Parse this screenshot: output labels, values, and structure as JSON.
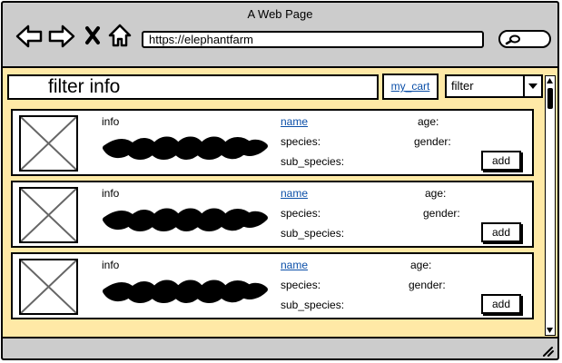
{
  "window": {
    "title": "A Web Page"
  },
  "browser": {
    "url": "https://elephantfarm"
  },
  "toolbar": {
    "filter_text": "filter info",
    "cart_label": "my_cart",
    "filter_select_value": "filter"
  },
  "items": [
    {
      "info_label": "info",
      "name_label": "name",
      "species_label": "species:",
      "subspecies_label": "sub_species:",
      "age_label": "age:",
      "gender_label": "gender:",
      "add_label": "add"
    },
    {
      "info_label": "info",
      "name_label": "name",
      "species_label": "species:",
      "subspecies_label": "sub_species:",
      "age_label": "age:",
      "gender_label": "gender:",
      "add_label": "add"
    },
    {
      "info_label": "info",
      "name_label": "name",
      "species_label": "species:",
      "subspecies_label": "sub_species:",
      "age_label": "age:",
      "gender_label": "gender:",
      "add_label": "add"
    }
  ],
  "colors": {
    "content_bg": "#ffe9a6",
    "window_bg": "#cccccc",
    "link": "#0b4fa8"
  }
}
